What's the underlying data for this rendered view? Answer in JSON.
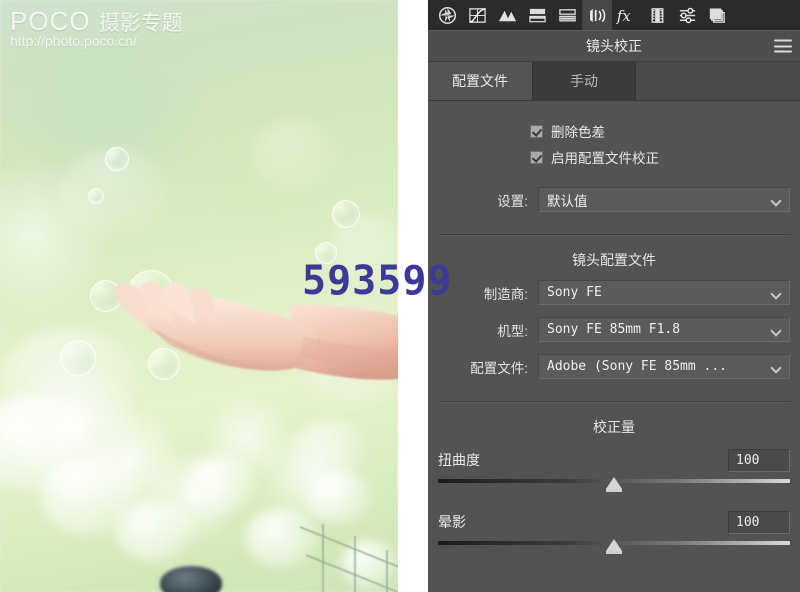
{
  "photo": {
    "watermark": {
      "brand": "POCO",
      "brand_cn": "摄影专题",
      "url": "http://photo.poco.cn/"
    },
    "overlay_text": "593599",
    "overlay_color": "#3b3a96",
    "alt": "blurred green bokeh background with an open hand and floating soap bubbles"
  },
  "panel": {
    "title": "镜头校正",
    "menu_icon": "hamburger-menu-icon",
    "toolbar": [
      {
        "name": "basic-aperture-icon",
        "active": false
      },
      {
        "name": "tone-curve-icon",
        "active": false
      },
      {
        "name": "hsl-grayscale-icon",
        "active": false
      },
      {
        "name": "split-toning-icon",
        "active": false
      },
      {
        "name": "detail-icon",
        "active": false
      },
      {
        "name": "lens-correction-icon",
        "active": true
      },
      {
        "name": "effects-fx-icon",
        "active": false
      },
      {
        "name": "camera-calibration-icon",
        "active": false
      },
      {
        "name": "presets-sliders-icon",
        "active": false
      },
      {
        "name": "snapshots-stack-icon",
        "active": false
      }
    ],
    "tabs": [
      {
        "label": "配置文件",
        "active": true
      },
      {
        "label": "手动",
        "active": false
      }
    ],
    "checkboxes": [
      {
        "label": "删除色差",
        "checked": true
      },
      {
        "label": "启用配置文件校正",
        "checked": true
      }
    ],
    "settings": {
      "label": "设置:",
      "value": "默认值"
    },
    "lens_profile": {
      "section_title": "镜头配置文件",
      "fields": [
        {
          "label": "制造商:",
          "value": "Sony FE"
        },
        {
          "label": "机型:",
          "value": "Sony FE 85mm F1.8"
        },
        {
          "label": "配置文件:",
          "value": "Adobe (Sony FE 85mm ..."
        }
      ]
    },
    "correction_amount": {
      "section_title": "校正量",
      "sliders": [
        {
          "label": "扭曲度",
          "value": "100",
          "position_pct": 50
        },
        {
          "label": "晕影",
          "value": "100",
          "position_pct": 50
        }
      ]
    }
  },
  "theme": {
    "panel_bg": "#535353",
    "toolbar_bg": "#2b2b2b",
    "titlebar_bg": "#4e4e4e",
    "text": "#e6e6e6",
    "accent_active_tab": "#545454"
  }
}
